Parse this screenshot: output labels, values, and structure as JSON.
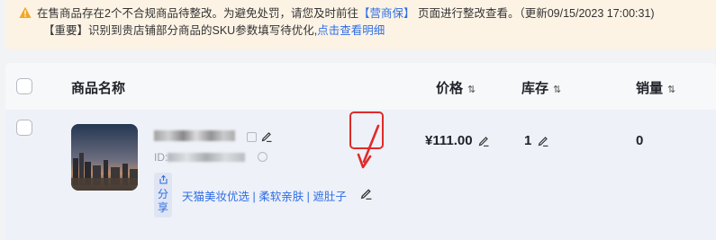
{
  "notice": {
    "line1_prefix": "在售商品存在2个不合规商品待整改。为避免处罚，请您及时前往",
    "line1_link": "【营商保】",
    "line1_suffix": " 页面进行整改查看。（更新09/15/2023 17:00:31)",
    "line2_prefix": "【重要】识别到贵店铺部分商品的SKU参数填写待优化,",
    "line2_link": "点击查看明细",
    "icon": "warning-triangle-icon",
    "icon_color": "#f5a623"
  },
  "table": {
    "headers": {
      "name": "商品名称",
      "price": "价格",
      "stock": "库存",
      "sales": "销量"
    },
    "sort_icon": "⇅",
    "rows": [
      {
        "id_prefix": "ID:",
        "share_label_1": "分",
        "share_label_2": "享",
        "tags": "天猫美妆优选 | 柔软亲肤 | 遮肚子",
        "price": "¥111.00",
        "stock": "1",
        "sales": "0"
      }
    ]
  },
  "colors": {
    "accent": "#2e6ee6",
    "highlight": "#e02a2a",
    "notice_bg": "#fcf3e5"
  }
}
